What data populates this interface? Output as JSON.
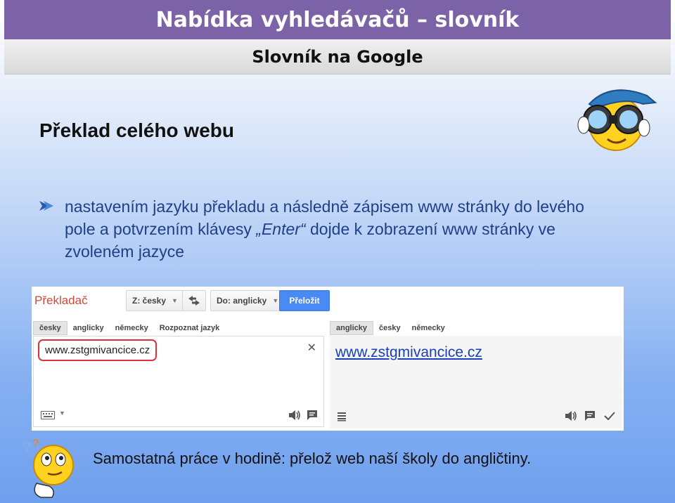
{
  "header": {
    "title": "Nabídka vyhledávačů – slovník",
    "subtitle": "Slovník na Google"
  },
  "slide": {
    "heading": "Překlad celého webu",
    "bullet_before": "nastavením jazyku překladu a následně zápisem www stránky do levého pole a potvrzením klávesy ",
    "bullet_enter": "„Enter“",
    "bullet_after": " dojde k zobrazení www stránky ve zvoleném jazyce",
    "task": "Samostatná práce v hodině: přelož web naší školy do angličtiny."
  },
  "translator": {
    "title": "Překladač",
    "from_label": "Z: česky",
    "to_label": "Do: anglicky",
    "translate_button": "Přeložit",
    "source_tabs": [
      "česky",
      "anglicky",
      "německy",
      "Rozpoznat jazyk"
    ],
    "target_tabs": [
      "anglicky",
      "česky",
      "německy"
    ],
    "input_value": "www.zstgmivancice.cz",
    "output_value": "www.zstgmivancice.cz",
    "colors": {
      "title": "#d14836",
      "button": "#4a8af4",
      "highlight": "#d9323c",
      "link": "#1a3fb6"
    }
  },
  "icons": [
    "bullet-arrow-icon",
    "swap-icon",
    "keyboard-icon",
    "speaker-icon",
    "feedback-icon",
    "list-icon",
    "check-icon",
    "close-icon",
    "binoculars-smiley-icon",
    "thinking-smiley-icon"
  ]
}
